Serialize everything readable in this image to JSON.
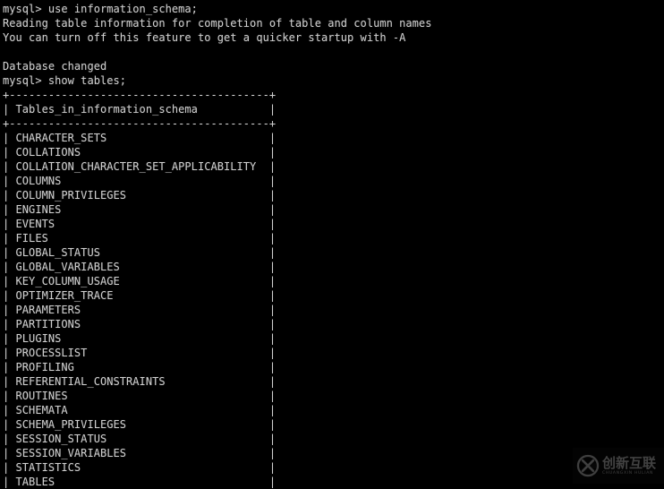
{
  "terminal": {
    "background_color": "#000000",
    "text_color": "#cfcfcf",
    "session": {
      "command_1": "mysql> use information_schema;",
      "notice_line_1": "Reading table information for completion of table and column names",
      "notice_line_2": "You can turn off this feature to get a quicker startup with -A",
      "blank_1": "",
      "status": "Database changed",
      "command_2": "mysql> show tables;"
    },
    "result_table": {
      "border_top": "+----------------------------------------+",
      "header_row": "| Tables_in_information_schema           |",
      "border_mid": "+----------------------------------------+",
      "column_header": "Tables_in_information_schema",
      "rows": [
        "CHARACTER_SETS",
        "COLLATIONS",
        "COLLATION_CHARACTER_SET_APPLICABILITY",
        "COLUMNS",
        "COLUMN_PRIVILEGES",
        "ENGINES",
        "EVENTS",
        "FILES",
        "GLOBAL_STATUS",
        "GLOBAL_VARIABLES",
        "KEY_COLUMN_USAGE",
        "OPTIMIZER_TRACE",
        "PARAMETERS",
        "PARTITIONS",
        "PLUGINS",
        "PROCESSLIST",
        "PROFILING",
        "REFERENTIAL_CONSTRAINTS",
        "ROUTINES",
        "SCHEMATA",
        "SCHEMA_PRIVILEGES",
        "SESSION_STATUS",
        "SESSION_VARIABLES",
        "STATISTICS",
        "TABLES"
      ]
    }
  },
  "watermark": {
    "chinese_text": "创新互联",
    "latin_text": "CHUANGXIN HULIAN",
    "icon": "circled-x-logo-icon"
  }
}
